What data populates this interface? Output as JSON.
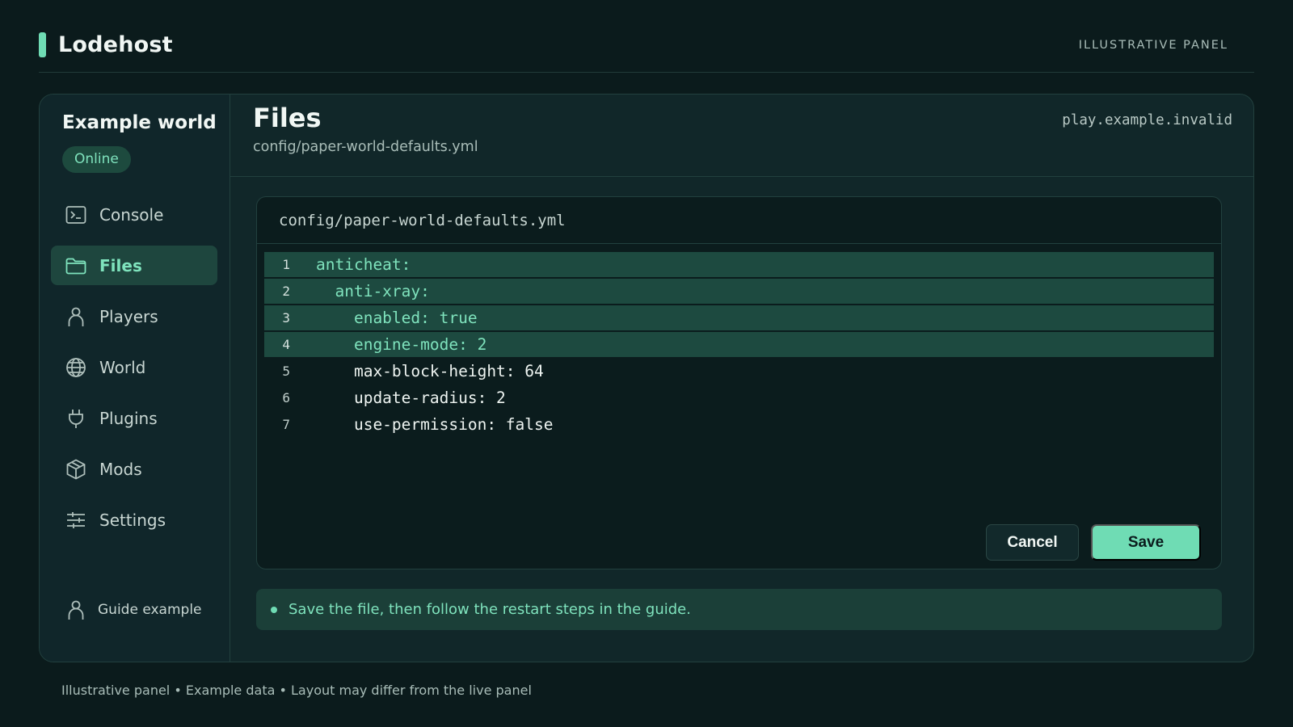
{
  "app": {
    "brand": "Lodehost",
    "tag": "ILLUSTRATIVE PANEL",
    "accent": "#6fdcb4"
  },
  "sidebar": {
    "world_name": "Example world",
    "status": "Online",
    "items": [
      {
        "label": "Console",
        "icon": "terminal-icon",
        "active": false
      },
      {
        "label": "Files",
        "icon": "folder-icon",
        "active": true
      },
      {
        "label": "Players",
        "icon": "person-icon",
        "active": false
      },
      {
        "label": "World",
        "icon": "globe-icon",
        "active": false
      },
      {
        "label": "Plugins",
        "icon": "plug-icon",
        "active": false
      },
      {
        "label": "Mods",
        "icon": "box-icon",
        "active": false
      },
      {
        "label": "Settings",
        "icon": "sliders-icon",
        "active": false
      }
    ],
    "user": {
      "label": "Guide example",
      "icon": "person-icon"
    }
  },
  "main": {
    "title": "Files",
    "path": "config/paper-world-defaults.yml",
    "host": "play.example.invalid"
  },
  "editor": {
    "filename": "config/paper-world-defaults.yml",
    "lines": [
      {
        "num": "1",
        "text": "anticheat:",
        "highlighted": true
      },
      {
        "num": "2",
        "text": "  anti-xray:",
        "highlighted": true
      },
      {
        "num": "3",
        "text": "    enabled: true",
        "highlighted": true
      },
      {
        "num": "4",
        "text": "    engine-mode: 2",
        "highlighted": true
      },
      {
        "num": "5",
        "text": "    max-block-height: 64",
        "highlighted": false
      },
      {
        "num": "6",
        "text": "    update-radius: 2",
        "highlighted": false
      },
      {
        "num": "7",
        "text": "    use-permission: false",
        "highlighted": false
      }
    ],
    "cancel_label": "Cancel",
    "save_label": "Save"
  },
  "notice": {
    "text": "Save the file, then follow the restart steps in the guide."
  },
  "footer": {
    "text": "Illustrative panel • Example data • Layout may differ from the live panel"
  }
}
